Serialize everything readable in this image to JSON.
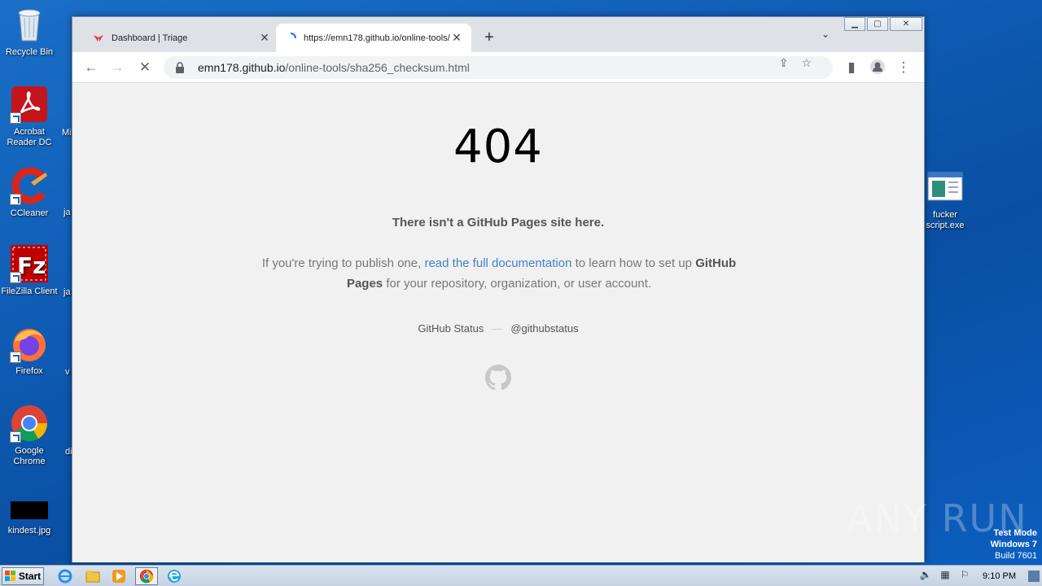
{
  "desktop": {
    "icons": [
      {
        "label": "Recycle Bin"
      },
      {
        "label": "Acrobat Reader DC"
      },
      {
        "label": "CCleaner"
      },
      {
        "label": "FileZilla Client"
      },
      {
        "label": "Firefox"
      },
      {
        "label": "Google Chrome"
      },
      {
        "label": "kindest.jpg"
      },
      {
        "label": "fucker script.exe"
      }
    ],
    "partial_labels": [
      "Mi",
      "ja",
      "ja",
      "v",
      "di"
    ]
  },
  "browser": {
    "tabs": [
      {
        "title": "Dashboard | Triage",
        "active": false
      },
      {
        "title": "https://emn178.github.io/online-tools/",
        "active": true
      }
    ],
    "new_tab": "+",
    "url_host": "emn178.github.io",
    "url_path": "/online-tools/sha256_checksum.html"
  },
  "page": {
    "code": "404",
    "lead": "There isn't a GitHub Pages site here.",
    "desc_pre": "If you're trying to publish one, ",
    "desc_link": "read the full documentation",
    "desc_mid": " to learn how to set up ",
    "desc_bold": "GitHub Pages",
    "desc_post": " for your repository, organization, or user account.",
    "status_link": "GitHub Status",
    "status_dash": "—",
    "twitter_link": "@githubstatus"
  },
  "taskbar": {
    "start_label": "Start",
    "clock": "9:10 PM"
  },
  "overlay": {
    "watermark": "ANY RUN",
    "test_mode": "Test Mode",
    "os": "Windows 7",
    "build": "Build 7601"
  },
  "colors": {
    "link": "#4183c4",
    "desktop_bg": "#0f5cb5"
  }
}
